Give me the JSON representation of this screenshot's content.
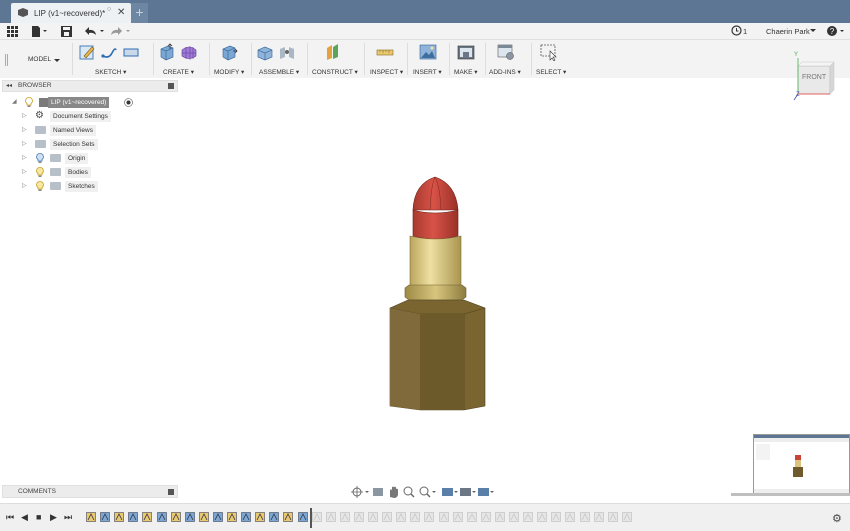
{
  "tab": {
    "title": "LIP (v1~recovered)*",
    "dirty_dot": "○",
    "close": "✕",
    "new_tab": "+"
  },
  "appbar": {
    "jobs_count": "1",
    "user": "Chaerin Park"
  },
  "toolbar": {
    "mode": "MODEL",
    "groups": [
      "SKETCH ▾",
      "CREATE ▾",
      "MODIFY ▾",
      "ASSEMBLE ▾",
      "CONSTRUCT ▾",
      "INSPECT ▾",
      "INSERT ▾",
      "MAKE ▾",
      "ADD-INS ▾",
      "SELECT ▾"
    ]
  },
  "browser": {
    "title": "BROWSER",
    "root": "LIP (v1~recovered)",
    "items": [
      "Document Settings",
      "Named Views",
      "Selection Sets",
      "Origin",
      "Bodies",
      "Sketches"
    ]
  },
  "viewcube": {
    "face": "FRONT",
    "axis_y": "Y",
    "axis_z": "Z"
  },
  "comments": {
    "title": "COMMENTS"
  },
  "colors": {
    "tabbar": "#5c7694",
    "lipstick_tip": "#c8443b",
    "lipstick_gold": "#d9c67c",
    "lipstick_case": "#6e5a2c"
  }
}
